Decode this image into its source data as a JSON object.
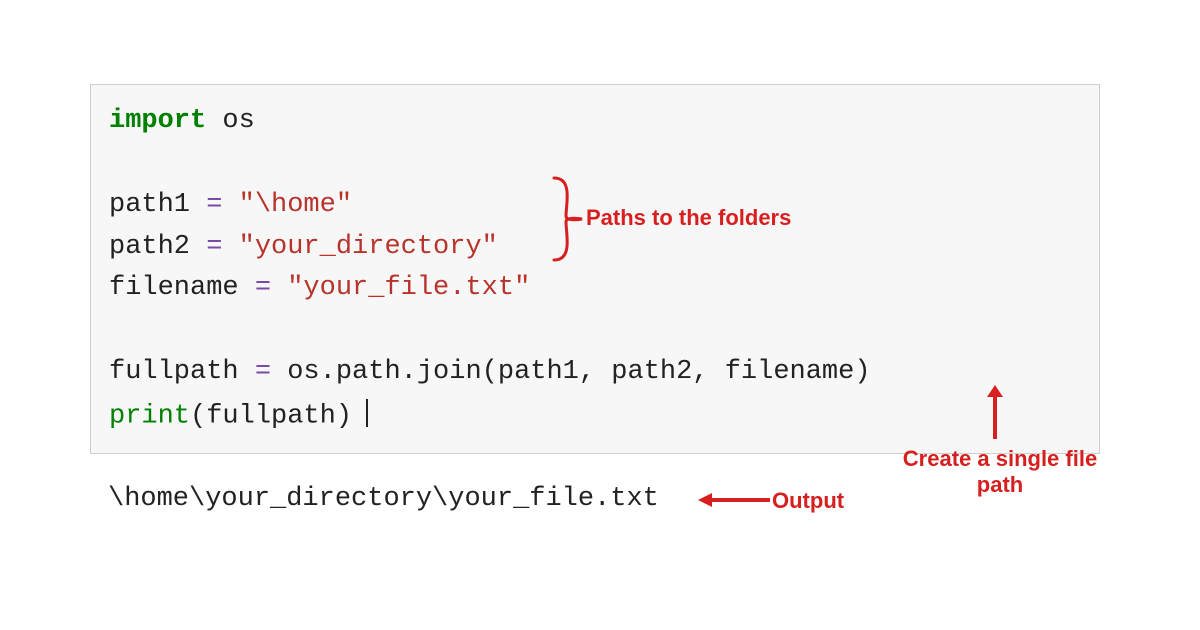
{
  "code": {
    "line1_keyword": "import",
    "line1_module": "os",
    "line2_name": "path1",
    "line2_eq": "=",
    "line2_str": "\"\\home\"",
    "line3_name": "path2",
    "line3_eq": "=",
    "line3_str": "\"your_directory\"",
    "line4_name": "filename",
    "line4_eq": "=",
    "line4_str": "\"your_file.txt\"",
    "line5_name": "fullpath",
    "line5_eq": "=",
    "line5_expr": "os.path.join(path1, path2, filename)",
    "line6_fn": "print",
    "line6_arg": "(fullpath)"
  },
  "output": "\\home\\your_directory\\your_file.txt",
  "annotations": {
    "paths_label": "Paths to the folders",
    "create_label_line1": "Create a single file",
    "create_label_line2": "path",
    "output_label": "Output"
  },
  "colors": {
    "annotation": "#d81f1f",
    "keyword": "#008000",
    "string": "#b7332b",
    "operator": "#7a4aa8",
    "code_bg": "#f7f7f7",
    "code_border": "#cfcfcf"
  }
}
